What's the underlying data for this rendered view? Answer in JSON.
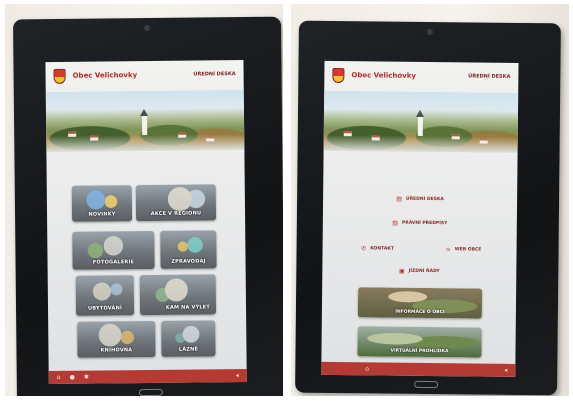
{
  "left_screen": {
    "town_name": "Obec Velichovky",
    "board_label": "ÚŘEDNÍ DESKA",
    "tiles": [
      {
        "label": "NOVINKY",
        "icon": "newspaper-icon"
      },
      {
        "label": "AKCE V REGIONU",
        "icon": "event-icon"
      },
      {
        "label": "FOTOGALERIE",
        "icon": "camera-icon"
      },
      {
        "label": "ZPRAVODAJ",
        "icon": "book-icon"
      },
      {
        "label": "UBYTOVÁNÍ",
        "icon": "house-icon"
      },
      {
        "label": "KAM NA VÝLET",
        "icon": "map-icon"
      },
      {
        "label": "KNIHOVNA",
        "icon": "library-icon"
      },
      {
        "label": "LÁZNĚ",
        "icon": "spa-icon"
      }
    ],
    "bottom_icons": [
      "home-icon",
      "info-icon",
      "settings-icon",
      "back-icon"
    ]
  },
  "right_screen": {
    "town_name": "Obec Velichovky",
    "board_label": "ÚŘEDNÍ DESKA",
    "menu": [
      {
        "label": "ÚŘEDNÍ DESKA",
        "icon": "document-icon"
      },
      {
        "label": "PRÁVNÍ PŘEDPISY",
        "icon": "law-icon"
      },
      {
        "label": "KONTAKT",
        "icon": "phone-icon"
      },
      {
        "label": "WEB OBCE",
        "icon": "link-icon"
      },
      {
        "label": "JÍZDNÍ ŘÁDY",
        "icon": "bus-icon"
      }
    ],
    "banners": [
      {
        "label": "INFORMACE O OBCI"
      },
      {
        "label": "VIRTUÁLNÍ PROHLÍDKA"
      }
    ],
    "bottom_icons": [
      "home-icon",
      "back-icon"
    ]
  },
  "colors": {
    "brand_red": "#b52a24",
    "bottom_bar": "#b53a34",
    "bezel": "#15171a"
  }
}
